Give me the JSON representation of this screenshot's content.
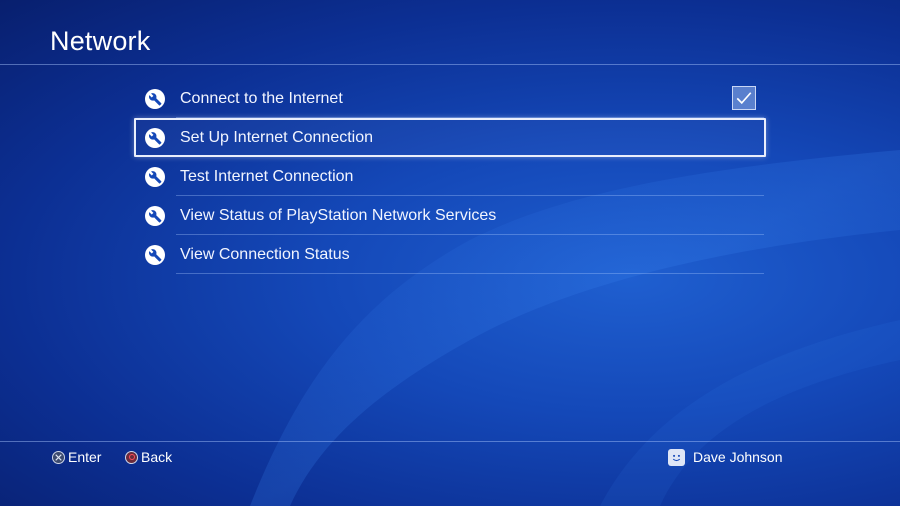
{
  "header": {
    "title": "Network"
  },
  "menu": {
    "items": [
      {
        "label": "Connect to the Internet",
        "icon": "wrench-icon",
        "checked": true
      },
      {
        "label": "Set Up Internet Connection",
        "icon": "wrench-icon",
        "selected": true
      },
      {
        "label": "Test Internet Connection",
        "icon": "wrench-icon"
      },
      {
        "label": "View Status of PlayStation Network Services",
        "icon": "wrench-icon"
      },
      {
        "label": "View Connection Status",
        "icon": "wrench-icon"
      }
    ]
  },
  "footer": {
    "enter_label": "Enter",
    "back_label": "Back",
    "user_name": "Dave Johnson"
  },
  "colors": {
    "background": "#1448b8",
    "accent": "#ffffff",
    "selection_border": "#e9eefc"
  }
}
